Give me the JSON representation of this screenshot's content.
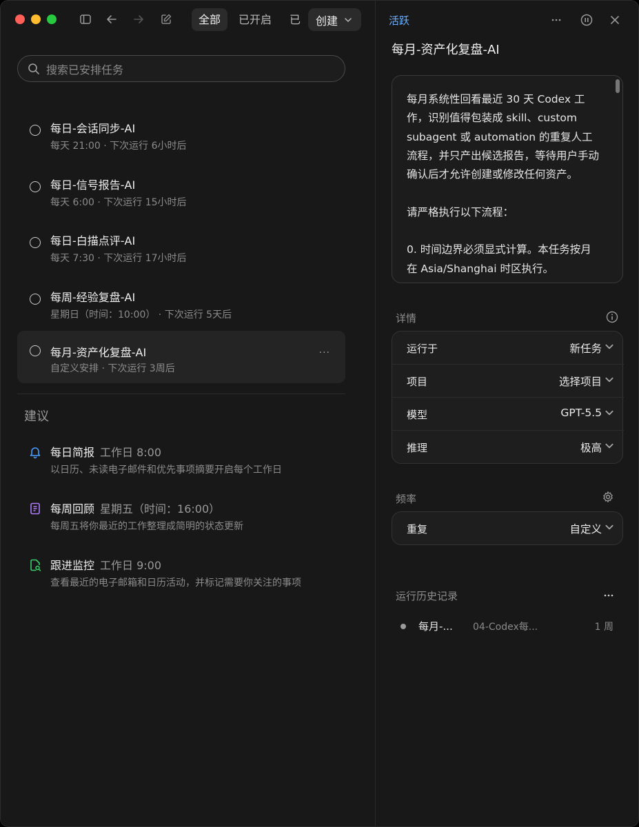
{
  "toolbar": {
    "tabs": [
      "全部",
      "已开启",
      "已"
    ],
    "create_label": "创建"
  },
  "search": {
    "placeholder": "搜索已安排任务"
  },
  "tasks": [
    {
      "title": "每日-会话同步-AI",
      "schedule": "每天 21:00",
      "next": "下次运行 6小时后"
    },
    {
      "title": "每日-信号报告-AI",
      "schedule": "每天 6:00",
      "next": "下次运行 15小时后"
    },
    {
      "title": "每日-白描点评-AI",
      "schedule": "每天 7:30",
      "next": "下次运行 17小时后"
    },
    {
      "title": "每周-经验复盘-AI",
      "schedule": "星期日（时间：10:00）",
      "next": "下次运行 5天后"
    },
    {
      "title": "每月-资产化复盘-AI",
      "schedule": "自定义安排",
      "next": "下次运行 3周后"
    }
  ],
  "suggestions_label": "建议",
  "suggestions": [
    {
      "title": "每日简报",
      "time": "工作日 8:00",
      "desc": "以日历、未读电子邮件和优先事项摘要开启每个工作日",
      "icon": "bell-icon",
      "color": "#4a9eff"
    },
    {
      "title": "每周回顾",
      "time": "星期五（时间：16:00）",
      "desc": "每周五将你最近的工作整理成简明的状态更新",
      "icon": "document-icon",
      "color": "#b07cff"
    },
    {
      "title": "跟进监控",
      "time": "工作日 9:00",
      "desc": "查看最近的电子邮箱和日历活动，并标记需要你关注的事项",
      "icon": "file-search-icon",
      "color": "#3ccf6a"
    }
  ],
  "detail": {
    "status": "活跃",
    "title": "每月-资产化复盘-AI",
    "prompt": "每月系统性回看最近 30 天 Codex 工作，识别值得包装成 skill、custom subagent 或 automation 的重复人工流程，并只产出候选报告，等待用户手动确认后才允许创建或修改任何资产。\n\n请严格执行以下流程：\n\n0. 时间边界必须显式计算。本任务按月在 Asia/Shanghai 时区执行。",
    "details_label": "详情",
    "rows": [
      {
        "label": "运行于",
        "value": "新任务"
      },
      {
        "label": "项目",
        "value": "选择项目"
      },
      {
        "label": "模型",
        "value": "GPT-5.5"
      },
      {
        "label": "推理",
        "value": "极高"
      }
    ],
    "frequency_label": "频率",
    "repeat": {
      "label": "重复",
      "value": "自定义"
    },
    "history_label": "运行历史记录",
    "history": [
      {
        "name": "每月-...",
        "thread": "04-Codex每...",
        "age": "1 周"
      }
    ]
  },
  "colors": {
    "accent": "#6fb1ff",
    "background": "#181818"
  }
}
